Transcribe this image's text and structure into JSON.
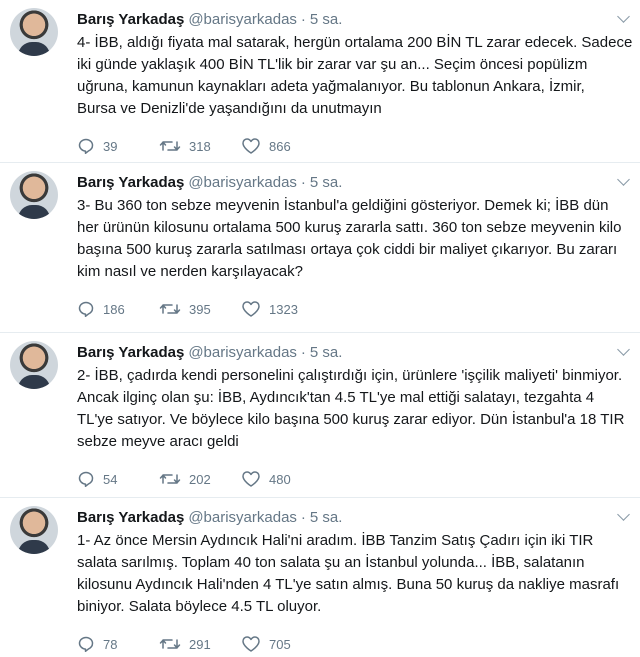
{
  "tweets": [
    {
      "name": "Barış Yarkadaş",
      "handle": "@barisyarkadas",
      "dot": "·",
      "time": "5 sa.",
      "lines": [
        "4- İBB, aldığı fiyata mal satarak, hergün ortalama 200 BİN TL zarar edecek. Sadece",
        "iki günde yaklaşık 400 BİN TL'lik bir zarar var şu an... Seçim öncesi popülizm",
        "uğruna, kamunun kaynakları adeta yağmalanıyor. Bu tablonun Ankara, İzmir,",
        "Bursa ve Denizli'de yaşandığını da unutmayın"
      ],
      "replies": "39",
      "retweets": "318",
      "likes": "866"
    },
    {
      "name": "Barış Yarkadaş",
      "handle": "@barisyarkadas",
      "dot": "·",
      "time": "5 sa.",
      "lines": [
        "3- Bu 360 ton sebze meyvenin İstanbul'a geldiğini gösteriyor. Demek ki; İBB dün",
        "her ürünün kilosunu ortalama 500 kuruş zararla sattı. 360 ton sebze meyvenin kilo",
        "başına 500 kuruş zararla satılması ortaya çok ciddi bir maliyet çıkarıyor. Bu zararı",
        "kim nasıl ve nerden karşılayacak?"
      ],
      "replies": "186",
      "retweets": "395",
      "likes": "1323"
    },
    {
      "name": "Barış Yarkadaş",
      "handle": "@barisyarkadas",
      "dot": "·",
      "time": "5 sa.",
      "lines": [
        "2- İBB, çadırda kendi personelini çalıştırdığı için, ürünlere 'işçilik maliyeti' binmiyor.",
        "Ancak ilginç olan şu: İBB, Aydıncık'tan 4.5 TL'ye mal ettiği salatayı, tezgahta 4",
        "TL'ye satıyor. Ve böylece kilo başına 500 kuruş zarar ediyor. Dün İstanbul'a 18 TIR",
        "sebze meyve aracı geldi"
      ],
      "replies": "54",
      "retweets": "202",
      "likes": "480"
    },
    {
      "name": "Barış Yarkadaş",
      "handle": "@barisyarkadas",
      "dot": "·",
      "time": "5 sa.",
      "lines": [
        "1- Az önce Mersin Aydıncık Hali'ni aradım. İBB Tanzim Satış Çadırı için iki TIR",
        "salata sarılmış. Toplam 40 ton salata şu an İstanbul yolunda... İBB, salatanın",
        "kilosunu Aydıncık Hali'nden 4 TL'ye satın almış. Buna 50 kuruş da nakliye masrafı",
        "biniyor. Salata böylece 4.5 TL oluyor."
      ],
      "replies": "78",
      "retweets": "291",
      "likes": "705"
    }
  ],
  "icons": {
    "reply": "reply-icon",
    "retweet": "retweet-icon",
    "like": "heart-icon",
    "menu": "chevron-down-icon"
  },
  "colors": {
    "text": "#14171a",
    "muted": "#657786",
    "divider": "#e6ecf0"
  }
}
